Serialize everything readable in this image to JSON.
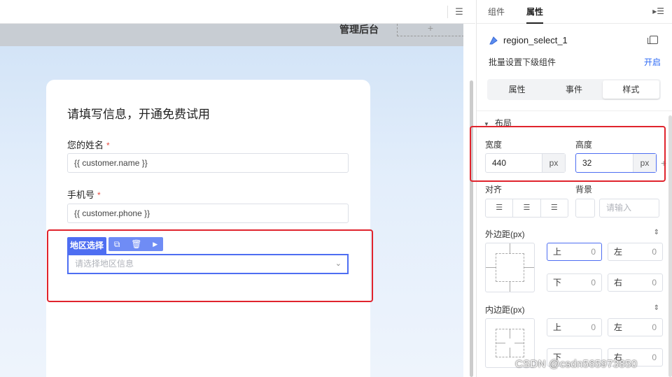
{
  "canvas": {
    "admin_label": "管理后台",
    "add_symbol": "+",
    "list_icon": "☰"
  },
  "form": {
    "title": "请填写信息，开通免费试用",
    "name_label": "您的姓名",
    "name_value": "{{ customer.name }}",
    "phone_label": "手机号",
    "phone_value": "{{ customer.phone }}",
    "required_mark": "*",
    "region_tag": "地区选择",
    "region_placeholder": "请选择地区信息"
  },
  "panel": {
    "tabs": [
      "组件",
      "属性"
    ],
    "active_tab": "属性",
    "component_name": "region_select_1",
    "batch_label": "批量设置下级组件",
    "batch_link": "开启",
    "segments": [
      "属性",
      "事件",
      "样式"
    ],
    "active_segment": "样式",
    "section_layout": "布局",
    "width_label": "宽度",
    "width_value": "440",
    "height_label": "高度",
    "height_value": "32",
    "unit": "px",
    "align_label": "对齐",
    "bg_label": "背景",
    "bg_placeholder": "请输入",
    "margin_label": "外边距(px)",
    "padding_label": "内边距(px)",
    "side_labels": {
      "top": "上",
      "left": "左",
      "bottom": "下",
      "right": "右"
    },
    "margin_values": {
      "top": "0",
      "left": "0",
      "bottom": "0",
      "right": "0"
    },
    "padding_values": {
      "top": "0",
      "left": "0",
      "bottom": "",
      "right": "0"
    }
  },
  "watermark": "CSDN @csdn565973850",
  "colors": {
    "accent": "#4e6ef2",
    "highlight": "#e0242d",
    "link": "#2f6bf5"
  }
}
